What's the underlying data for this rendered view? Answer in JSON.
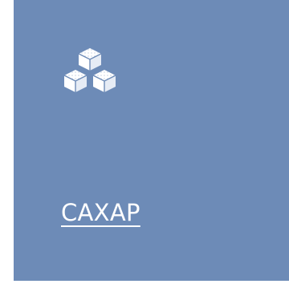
{
  "tile": {
    "label": "САХАР",
    "icon": "sugar-cubes-icon",
    "background_color": "#6d8bb7",
    "text_color": "#ffffff"
  }
}
